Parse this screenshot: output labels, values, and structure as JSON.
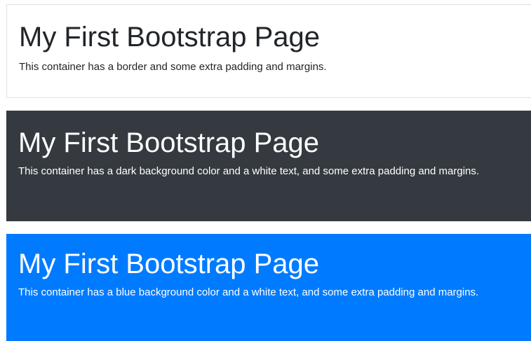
{
  "boxes": [
    {
      "heading": "My First Bootstrap Page",
      "text": "This container has a border and some extra padding and margins."
    },
    {
      "heading": "My First Bootstrap Page",
      "text": "This container has a dark background color and a white text, and some extra padding and margins."
    },
    {
      "heading": "My First Bootstrap Page",
      "text": "This container has a blue background color and a white text, and some extra padding and margins."
    }
  ],
  "colors": {
    "border": "#dee2e6",
    "dark_bg": "#343a40",
    "blue_bg": "#007bff",
    "dark_text": "#212529",
    "light_text": "#ffffff"
  }
}
